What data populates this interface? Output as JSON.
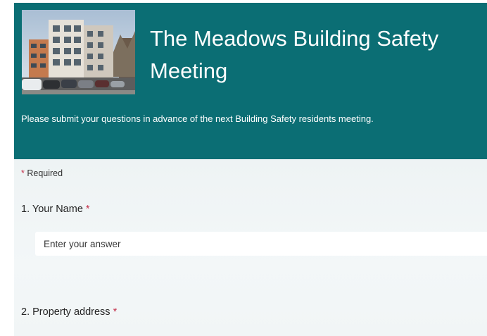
{
  "header": {
    "title": "The Meadows Building Safety Meeting",
    "description": "Please submit your questions in advance of the next Building Safety residents meeting.",
    "background_color": "#0b6e74"
  },
  "form": {
    "required_note": "Required",
    "required_marker": "*",
    "questions": [
      {
        "number": "1.",
        "label": "Your Name",
        "required": true,
        "placeholder": "Enter your answer"
      },
      {
        "number": "2.",
        "label": "Property address",
        "required": true
      }
    ]
  }
}
